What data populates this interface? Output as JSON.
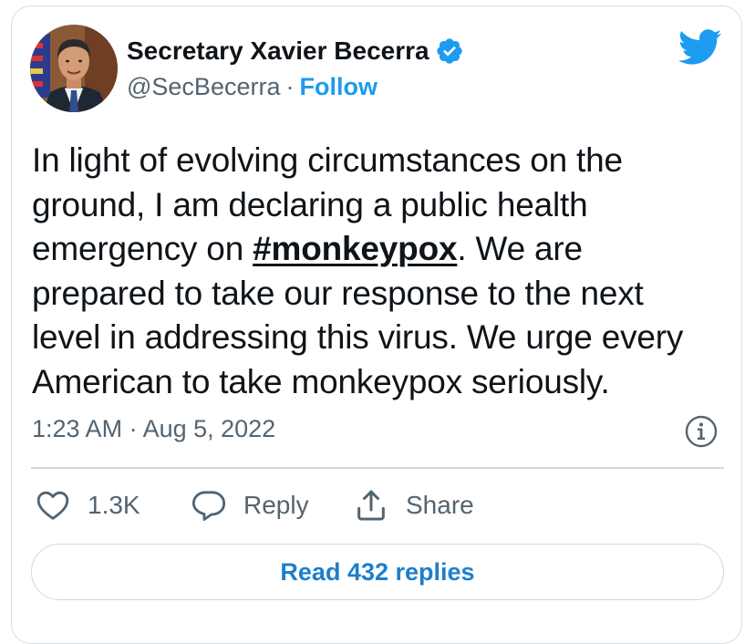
{
  "author": {
    "name": "Secretary Xavier Becerra",
    "handle": "@SecBecerra",
    "separator": "·",
    "follow_label": "Follow",
    "verified_icon": "verified-badge-icon",
    "avatar_icon": "profile-photo"
  },
  "brand_icon": "twitter-bird-icon",
  "tweet": {
    "lines": [
      "In light of evolving circumstances on the",
      "ground, I am declaring a public health",
      "emergency on ",
      "prepared to take our response to the next",
      "level in addressing this virus. We urge every",
      "American to take monkeypox seriously."
    ],
    "hashtag": "#monkeypox",
    "after_hashtag": ". We are"
  },
  "timestamp": "1:23 AM · Aug 5, 2022",
  "info_icon": "info-icon",
  "actions": {
    "like_count": "1.3K",
    "reply_label": "Reply",
    "share_label": "Share"
  },
  "read_replies_label": "Read 432 replies",
  "colors": {
    "brand_blue": "#1d9bf0",
    "text_primary": "#0f1419",
    "text_secondary": "#536471",
    "border": "#cfd9de"
  }
}
